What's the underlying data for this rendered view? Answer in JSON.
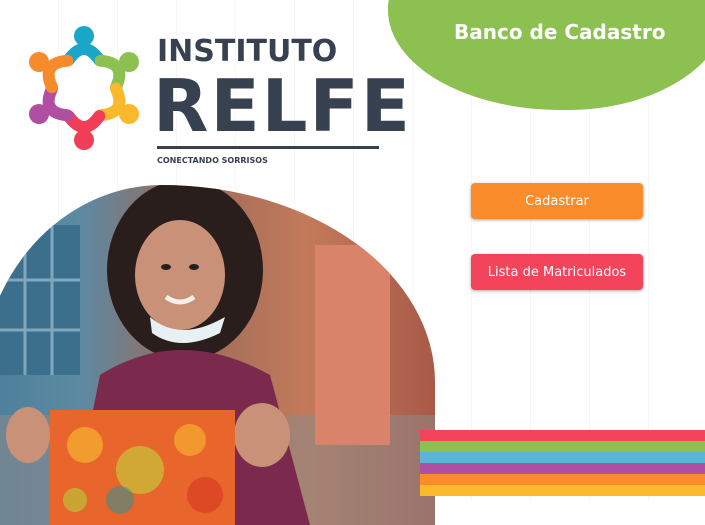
{
  "header": {
    "title": "Banco de Cadastro"
  },
  "logo": {
    "line1": "INSTITUTO",
    "line2": "RELFE",
    "tagline": "CONECTANDO SORRISOS",
    "people_colors": [
      "#1aa6c6",
      "#8cc151",
      "#fbb82d",
      "#ef3e55",
      "#b04ea1",
      "#f58b2c"
    ]
  },
  "actions": {
    "register_label": "Cadastrar",
    "enrolled_list_label": "Lista de Matriculados"
  },
  "colors": {
    "header_blob": "#8cc151",
    "register_button": "#fb8c2c",
    "enrolled_button": "#f3445c",
    "stripes": [
      "#f3445c",
      "#8cc151",
      "#5ab5d6",
      "#b04ea1",
      "#fb8c2c",
      "#fbb82d"
    ]
  },
  "photo": {
    "icon": "child-with-painting-photo"
  }
}
